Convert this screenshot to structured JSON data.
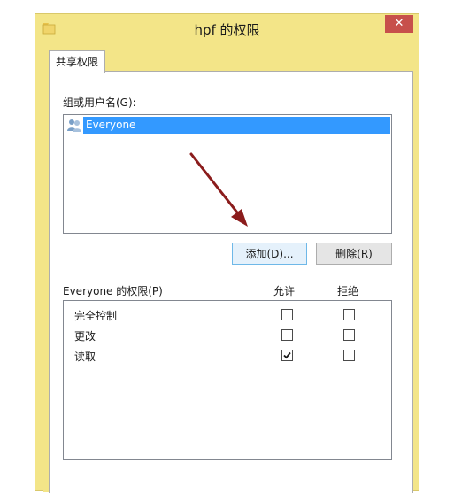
{
  "window": {
    "title": "hpf 的权限",
    "close_glyph": "✕"
  },
  "tab": {
    "label": "共享权限"
  },
  "group_section": {
    "label": "组或用户名(G):",
    "items": [
      {
        "label": "Everyone",
        "icon": "users-icon",
        "selected": true
      }
    ]
  },
  "buttons": {
    "add": "添加(D)...",
    "remove": "删除(R)"
  },
  "permissions": {
    "header_label": "Everyone 的权限(P)",
    "allow_label": "允许",
    "deny_label": "拒绝",
    "rows": [
      {
        "name": "完全控制",
        "allow": false,
        "deny": false
      },
      {
        "name": "更改",
        "allow": false,
        "deny": false
      },
      {
        "name": "读取",
        "allow": true,
        "deny": false
      }
    ]
  },
  "colors": {
    "window_frame": "#f3e588",
    "selection": "#3399ff",
    "close_button": "#c7504b",
    "annotation_arrow": "#8b1c1c"
  }
}
